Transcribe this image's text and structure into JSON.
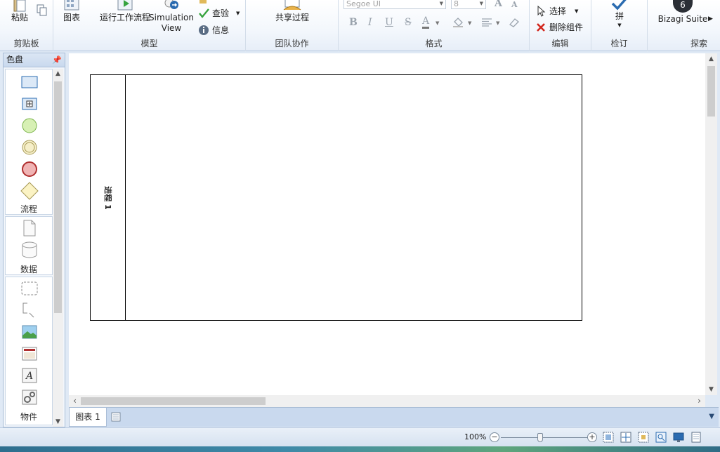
{
  "ribbon": {
    "clipboard": {
      "paste_label": "粘贴",
      "group_label": "剪贴板"
    },
    "model": {
      "diagram_label": "图表",
      "run_workflow_label": "运行工作流程",
      "simulation_line1": "Simulation",
      "simulation_line2": "View",
      "check_label": "查验",
      "info_label": "信息",
      "group_label": "模型"
    },
    "team": {
      "share_label": "共享过程",
      "group_label": "团队协作"
    },
    "format": {
      "font_name": "Segoe UI",
      "font_size": "8",
      "grow_font": "A",
      "shrink_font": "A",
      "bold": "B",
      "italic": "I",
      "underline": "U",
      "strike": "S",
      "font_color": "A",
      "group_label": "格式"
    },
    "edit": {
      "select_label": "选择",
      "delete_label": "删除组件",
      "group_label": "编辑"
    },
    "review": {
      "spell_label": "拼",
      "group_label": "检订"
    },
    "explore": {
      "suite_label": "Bizagi Suite",
      "group_label": "探索",
      "suite_badge": "6"
    }
  },
  "palette": {
    "title": "色盘",
    "pin": "ꟷ",
    "sections": [
      {
        "label": "流程"
      },
      {
        "label": "数据"
      },
      {
        "label": "物件"
      }
    ]
  },
  "canvas": {
    "pool_label": "进程 1"
  },
  "tabs": {
    "items": [
      {
        "label": "图表 1"
      }
    ]
  },
  "statusbar": {
    "zoom_percent": "100%",
    "zoom_out": "−",
    "zoom_in": "+",
    "zoom_level": 0.45
  },
  "colors": {
    "accent": "#2a6bb0",
    "start_event": "#d7f0b4",
    "end_event": "#f0b4b4",
    "gateway": "#fbf3c4"
  }
}
